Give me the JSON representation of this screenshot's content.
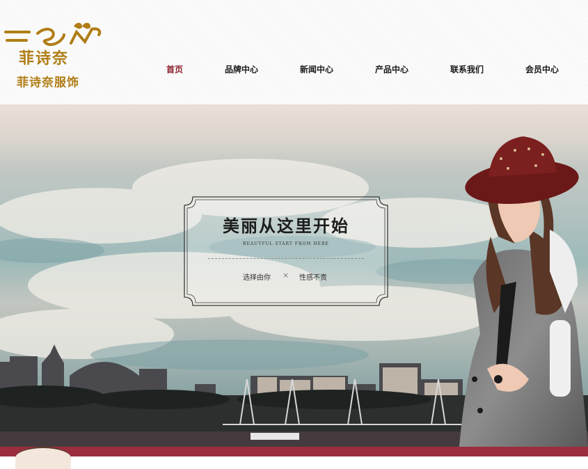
{
  "brand": {
    "script_name": "菲诗奈",
    "name": "菲诗奈服饰"
  },
  "nav": {
    "items": [
      {
        "label": "首页",
        "active": true
      },
      {
        "label": "品牌中心",
        "active": false
      },
      {
        "label": "新闻中心",
        "active": false
      },
      {
        "label": "产品中心",
        "active": false
      },
      {
        "label": "联系我们",
        "active": false
      },
      {
        "label": "会员中心",
        "active": false
      }
    ]
  },
  "banner": {
    "title": "美丽从这里开始",
    "subtitle": "BEAUTFUL START FROM HERE",
    "left_text": "选择由你",
    "separator": "×",
    "right_text": "性感不贵"
  },
  "colors": {
    "brand_gold": "#b07d16",
    "nav_active": "#8c1f2c",
    "footer_bar": "#9a2e3e"
  }
}
